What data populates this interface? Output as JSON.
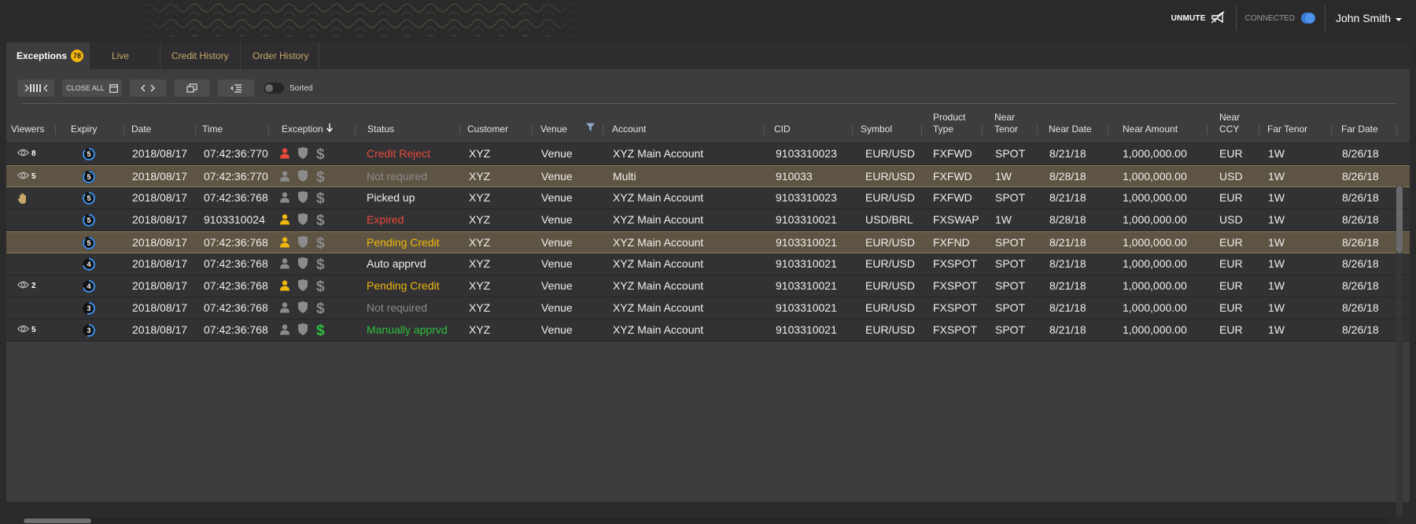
{
  "header": {
    "unmute_label": "UNMUTE",
    "connected_label": "CONNECTED",
    "user_name": "John Smith"
  },
  "tabs": [
    {
      "label": "Exceptions",
      "badge": "78",
      "active": true
    },
    {
      "label": "Live"
    },
    {
      "label": "Credit History"
    },
    {
      "label": "Order History"
    }
  ],
  "toolbar": {
    "close_all_label": "CLOSE ALL",
    "sorted_label": "Sorted"
  },
  "columns": {
    "viewers": "Viewers",
    "expiry": "Expiry",
    "date": "Date",
    "time": "Time",
    "exception": "Exception",
    "status": "Status",
    "customer": "Customer",
    "venue": "Venue",
    "account": "Account",
    "cid": "CID",
    "symbol": "Symbol",
    "product_type_1": "Product",
    "product_type_2": "Type",
    "near_tenor_1": "Near",
    "near_tenor_2": "Tenor",
    "near_date": "Near Date",
    "near_amount": "Near Amount",
    "near_ccy_1": "Near",
    "near_ccy_2": "CCY",
    "far_tenor": "Far Tenor",
    "far_date": "Far Date"
  },
  "rows": [
    {
      "viewer_icon": "eye",
      "viewers": "8",
      "expiry": "5",
      "date": "2018/08/17",
      "time": "07:42:36:770",
      "user_color": "red",
      "dollar_color": "grey",
      "status": "Credit Reject",
      "status_color": "red",
      "customer": "XYZ",
      "venue": "Venue",
      "account": "XYZ Main Account",
      "cid": "9103310023",
      "symbol": "EUR/USD",
      "product": "FXFWD",
      "near_tenor": "SPOT",
      "near_date": "8/21/18",
      "near_amount": "1,000,000.00",
      "near_ccy": "EUR",
      "far_tenor": "1W",
      "far_date": "8/26/18",
      "highlight": false
    },
    {
      "viewer_icon": "eye",
      "viewers": "5",
      "expiry": "5",
      "date": "2018/08/17",
      "time": "07:42:36:770",
      "user_color": "grey",
      "dollar_color": "grey",
      "status": "Not required",
      "status_color": "grey",
      "customer": "XYZ",
      "venue": "Venue",
      "account": "Multi",
      "cid": "910033",
      "symbol": "EUR/USD",
      "product": "FXFWD",
      "near_tenor": "1W",
      "near_date": "8/28/18",
      "near_amount": "1,000,000.00",
      "near_ccy": "USD",
      "far_tenor": "1W",
      "far_date": "8/26/18",
      "highlight": true
    },
    {
      "viewer_icon": "hand",
      "viewers": "",
      "expiry": "5",
      "date": "2018/08/17",
      "time": "07:42:36:768",
      "user_color": "grey",
      "dollar_color": "grey",
      "status": "Picked up",
      "status_color": "white",
      "customer": "XYZ",
      "venue": "Venue",
      "account": "XYZ Main Account",
      "cid": "9103310023",
      "symbol": "EUR/USD",
      "product": "FXFWD",
      "near_tenor": "SPOT",
      "near_date": "8/21/18",
      "near_amount": "1,000,000.00",
      "near_ccy": "EUR",
      "far_tenor": "1W",
      "far_date": "8/26/18",
      "highlight": false
    },
    {
      "viewer_icon": "",
      "viewers": "",
      "expiry": "5",
      "date": "2018/08/17",
      "time": "9103310024",
      "user_color": "yellow",
      "dollar_color": "grey",
      "status": "Expired",
      "status_color": "red",
      "customer": "XYZ",
      "venue": "Venue",
      "account": "XYZ Main Account",
      "cid": "9103310021",
      "symbol": "USD/BRL",
      "product": "FXSWAP",
      "near_tenor": "1W",
      "near_date": "8/28/18",
      "near_amount": "1,000,000.00",
      "near_ccy": "USD",
      "far_tenor": "1W",
      "far_date": "8/26/18",
      "highlight": false
    },
    {
      "viewer_icon": "",
      "viewers": "",
      "expiry": "5",
      "date": "2018/08/17",
      "time": "07:42:36:768",
      "user_color": "yellow",
      "dollar_color": "grey",
      "status": "Pending Credit",
      "status_color": "yellow",
      "customer": "XYZ",
      "venue": "Venue",
      "account": "XYZ Main Account",
      "cid": "9103310021",
      "symbol": "EUR/USD",
      "product": "FXFND",
      "near_tenor": "SPOT",
      "near_date": "8/21/18",
      "near_amount": "1,000,000.00",
      "near_ccy": "EUR",
      "far_tenor": "1W",
      "far_date": "8/26/18",
      "highlight": true
    },
    {
      "viewer_icon": "",
      "viewers": "",
      "expiry": "4",
      "date": "2018/08/17",
      "time": "07:42:36:768",
      "user_color": "grey",
      "dollar_color": "grey",
      "status": "Auto apprvd",
      "status_color": "white",
      "customer": "XYZ",
      "venue": "Venue",
      "account": "XYZ Main Account",
      "cid": "9103310021",
      "symbol": "EUR/USD",
      "product": "FXSPOT",
      "near_tenor": "SPOT",
      "near_date": "8/21/18",
      "near_amount": "1,000,000.00",
      "near_ccy": "EUR",
      "far_tenor": "1W",
      "far_date": "8/26/18",
      "highlight": false
    },
    {
      "viewer_icon": "eye",
      "viewers": "2",
      "expiry": "4",
      "date": "2018/08/17",
      "time": "07:42:36:768",
      "user_color": "yellow",
      "dollar_color": "grey",
      "status": "Pending Credit",
      "status_color": "yellow",
      "customer": "XYZ",
      "venue": "Venue",
      "account": "XYZ Main Account",
      "cid": "9103310021",
      "symbol": "EUR/USD",
      "product": "FXSPOT",
      "near_tenor": "SPOT",
      "near_date": "8/21/18",
      "near_amount": "1,000,000.00",
      "near_ccy": "EUR",
      "far_tenor": "1W",
      "far_date": "8/26/18",
      "highlight": false
    },
    {
      "viewer_icon": "",
      "viewers": "",
      "expiry": "3",
      "date": "2018/08/17",
      "time": "07:42:36:768",
      "user_color": "grey",
      "dollar_color": "grey",
      "status": "Not required",
      "status_color": "grey",
      "customer": "XYZ",
      "venue": "Venue",
      "account": "XYZ Main Account",
      "cid": "9103310021",
      "symbol": "EUR/USD",
      "product": "FXSPOT",
      "near_tenor": "SPOT",
      "near_date": "8/21/18",
      "near_amount": "1,000,000.00",
      "near_ccy": "EUR",
      "far_tenor": "1W",
      "far_date": "8/26/18",
      "highlight": false
    },
    {
      "viewer_icon": "eye",
      "viewers": "5",
      "expiry": "3",
      "date": "2018/08/17",
      "time": "07:42:36:768",
      "user_color": "grey",
      "dollar_color": "green",
      "status": "Manually apprvd",
      "status_color": "green",
      "customer": "XYZ",
      "venue": "Venue",
      "account": "XYZ Main Account",
      "cid": "9103310021",
      "symbol": "EUR/USD",
      "product": "FXSPOT",
      "near_tenor": "SPOT",
      "near_date": "8/21/18",
      "near_amount": "1,000,000.00",
      "near_ccy": "EUR",
      "far_tenor": "1W",
      "far_date": "8/26/18",
      "highlight": false
    }
  ],
  "colors": {
    "accent_yellow": "#f0b60d",
    "status_red": "#e8493a",
    "status_green": "#2fbf3c",
    "tab_gold": "#c8a86a",
    "highlight_row": "#5e5443"
  },
  "icons": {
    "unmute": "megaphone-icon",
    "viewers": "eye-icon",
    "picked_up": "hand-icon",
    "exception_user": "user-icon",
    "exception_shield": "shield-icon",
    "exception_dollar": "dollar-icon",
    "venue_filter": "filter-icon",
    "sort_desc": "arrow-down-icon",
    "user_menu": "caret-down-icon"
  }
}
